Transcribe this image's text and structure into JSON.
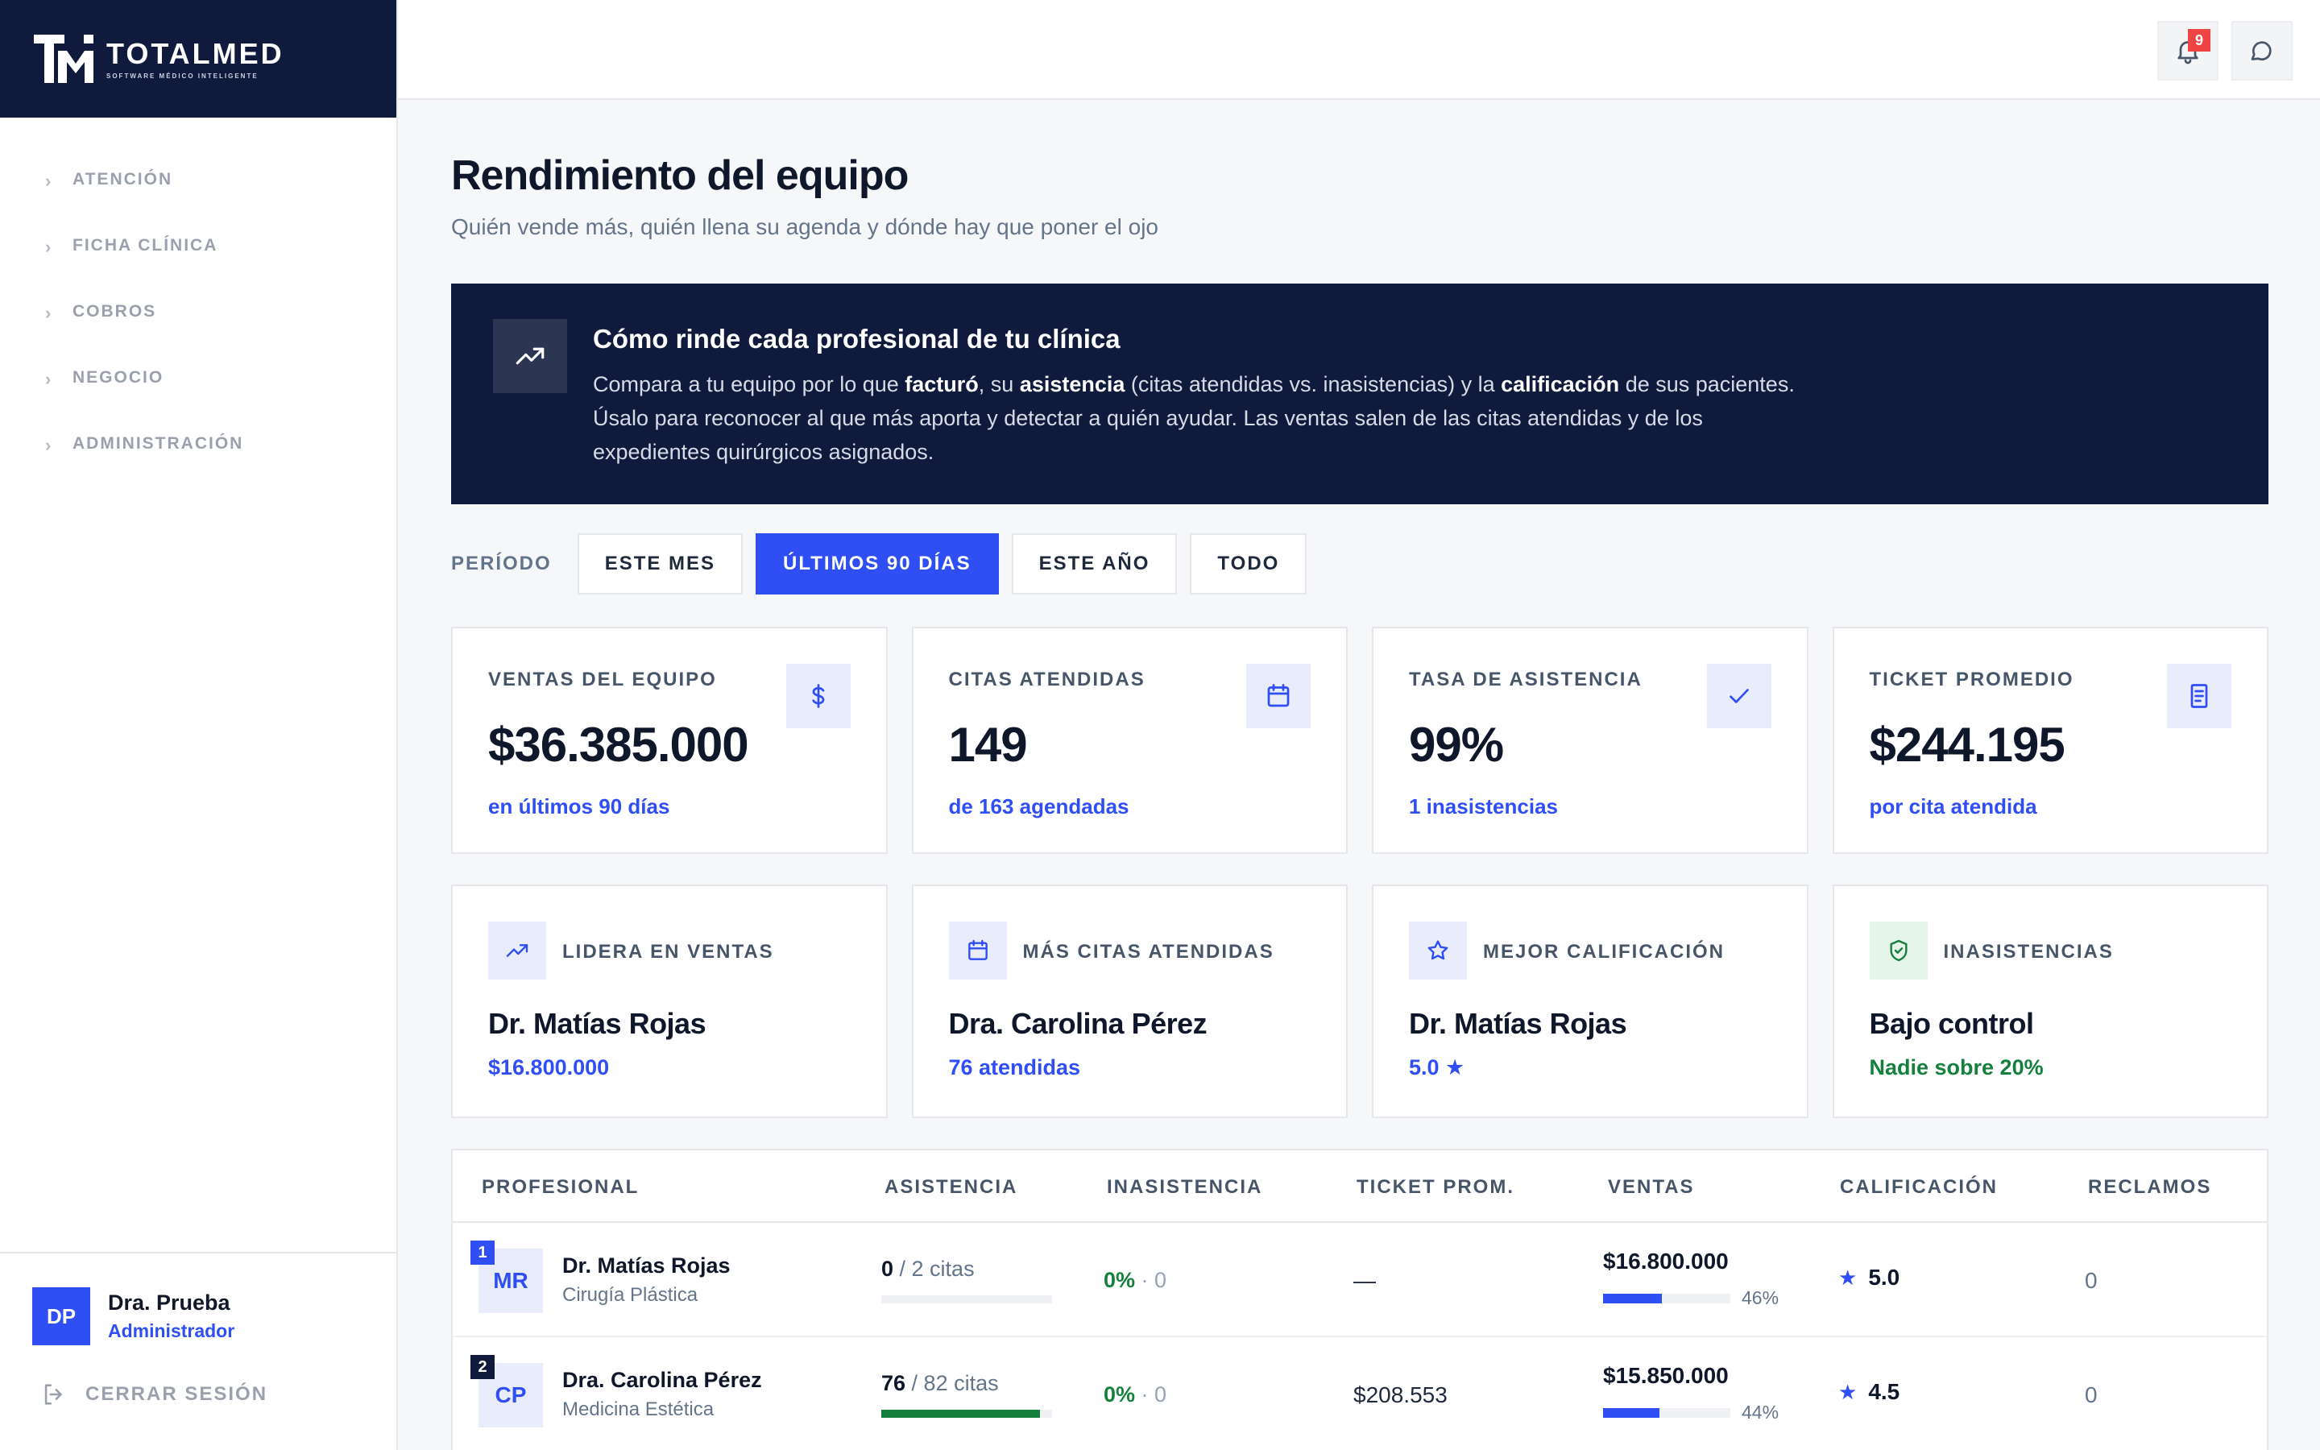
{
  "brand": {
    "name": "TOTALMED",
    "tagline": "SOFTWARE MÉDICO INTELIGENTE"
  },
  "sidebar": {
    "items": [
      {
        "label": "ATENCIÓN"
      },
      {
        "label": "FICHA CLÍNICA"
      },
      {
        "label": "COBROS"
      },
      {
        "label": "NEGOCIO"
      },
      {
        "label": "ADMINISTRACIÓN"
      }
    ],
    "user": {
      "initials": "DP",
      "name": "Dra. Prueba",
      "role": "Administrador"
    },
    "logout_label": "CERRAR SESIÓN"
  },
  "topbar": {
    "notifications_count": "9"
  },
  "page": {
    "title": "Rendimiento del equipo",
    "subtitle": "Quién vende más, quién llena su agenda y dónde hay que poner el ojo"
  },
  "hero": {
    "title": "Cómo rinde cada profesional de tu clínica",
    "p1": "Compara a tu equipo por lo que ",
    "b1": "facturó",
    "p2": ", su ",
    "b2": "asistencia",
    "p3": " (citas atendidas vs. inasistencias) y la ",
    "b3": "calificación",
    "p4": " de sus pacientes. Úsalo para reconocer al que más aporta y detectar a quién ayudar. Las ventas salen de las citas atendidas y de los expedientes quirúrgicos asignados."
  },
  "period": {
    "label": "PERÍODO",
    "options": [
      "ESTE MES",
      "ÚLTIMOS 90 DÍAS",
      "ESTE AÑO",
      "TODO"
    ],
    "active": "ÚLTIMOS 90 DÍAS"
  },
  "stats": [
    {
      "label": "VENTAS DEL EQUIPO",
      "value": "$36.385.000",
      "note": "en últimos 90 días",
      "icon": "dollar-icon"
    },
    {
      "label": "CITAS ATENDIDAS",
      "value": "149",
      "note": "de 163 agendadas",
      "icon": "calendar-icon"
    },
    {
      "label": "TASA DE ASISTENCIA",
      "value": "99%",
      "note": "1 inasistencias",
      "icon": "check-icon"
    },
    {
      "label": "TICKET PROMEDIO",
      "value": "$244.195",
      "note": "por cita atendida",
      "icon": "receipt-icon"
    }
  ],
  "highlights": [
    {
      "label": "LIDERA EN VENTAS",
      "name": "Dr. Matías Rojas",
      "note": "$16.800.000",
      "icon": "trend-up-icon"
    },
    {
      "label": "MÁS CITAS ATENDIDAS",
      "name": "Dra. Carolina Pérez",
      "note": "76 atendidas",
      "icon": "calendar-icon"
    },
    {
      "label": "MEJOR CALIFICACIÓN",
      "name": "Dr. Matías Rojas",
      "note": "5.0 ★",
      "icon": "star-icon"
    },
    {
      "label": "INASISTENCIAS",
      "name": "Bajo control",
      "note": "Nadie sobre 20%",
      "icon": "shield-check-icon"
    }
  ],
  "table": {
    "headers": [
      "PROFESIONAL",
      "ASISTENCIA",
      "INASISTENCIA",
      "TICKET PROM.",
      "VENTAS",
      "CALIFICACIÓN",
      "RECLAMOS"
    ],
    "rows": [
      {
        "rank": "1",
        "initials": "MR",
        "name": "Dr. Matías Rojas",
        "specialty": "Cirugía Plástica",
        "attended": "0",
        "attended_total": " / 2 citas",
        "attendance_fraction": 0,
        "no_show_pct": "0%",
        "no_show_count": " · 0",
        "ticket": "—",
        "sales": "$16.800.000",
        "sales_pct": "46%",
        "sales_fraction": 0.46,
        "rating": "5.0",
        "claims": "0"
      },
      {
        "rank": "2",
        "initials": "CP",
        "name": "Dra. Carolina Pérez",
        "specialty": "Medicina Estética",
        "attended": "76",
        "attended_total": " / 82 citas",
        "attendance_fraction": 0.93,
        "no_show_pct": "0%",
        "no_show_count": " · 0",
        "ticket": "$208.553",
        "sales": "$15.850.000",
        "sales_pct": "44%",
        "sales_fraction": 0.44,
        "rating": "4.5",
        "claims": "0"
      }
    ]
  },
  "colors": {
    "navy": "#101a3c",
    "accent": "#2f4ff5",
    "success": "#15803d",
    "badge": "#ef4444"
  }
}
